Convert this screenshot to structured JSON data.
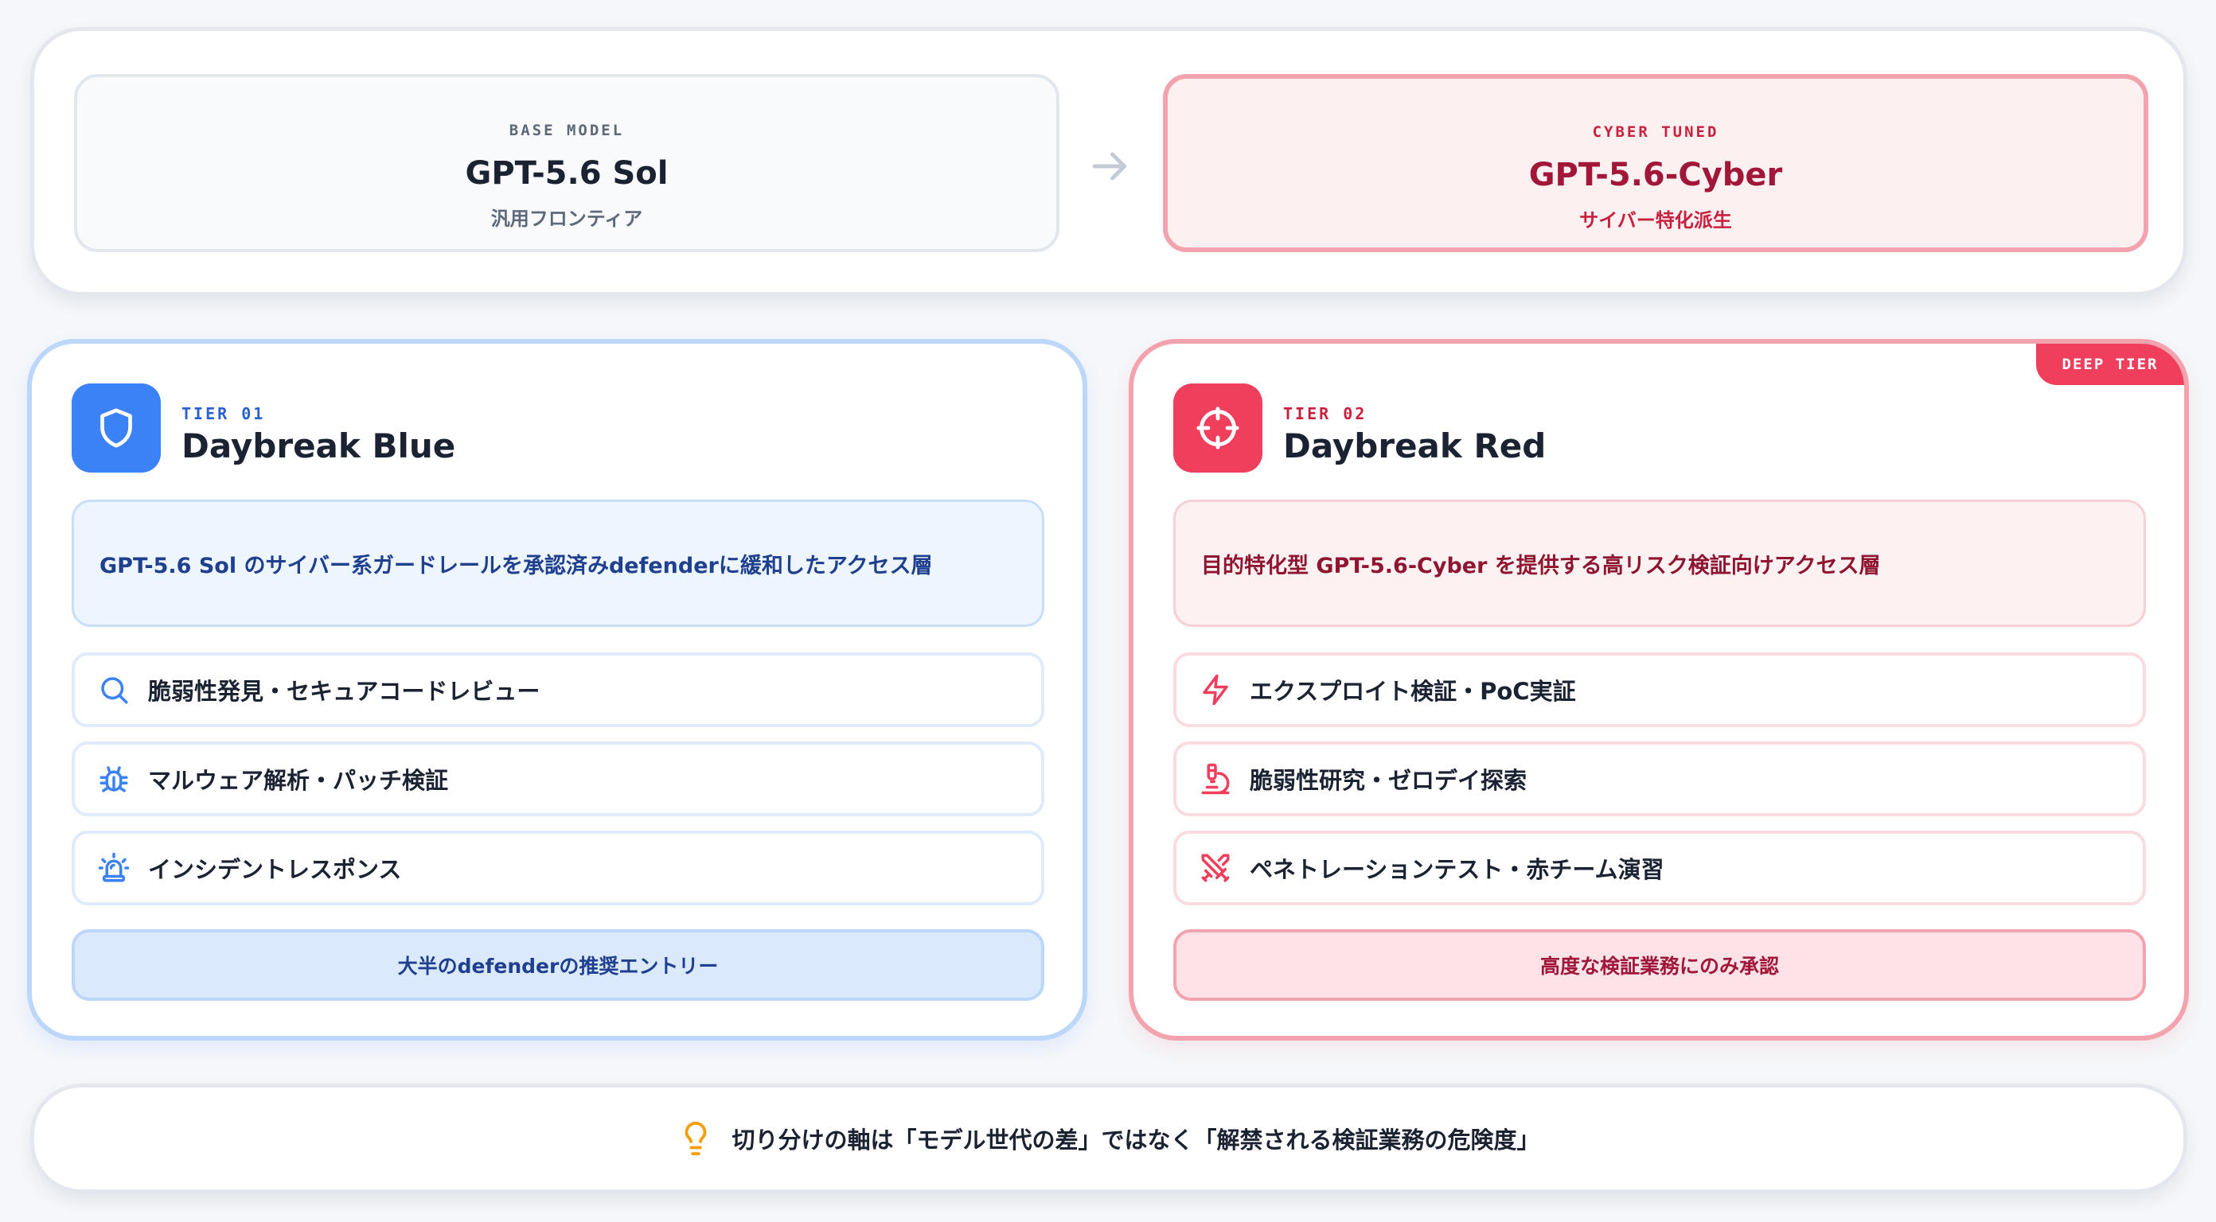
{
  "models": {
    "base": {
      "eyebrow": "BASE MODEL",
      "name": "GPT-5.6 Sol",
      "subtitle": "汎用フロンティア"
    },
    "cyber": {
      "eyebrow": "CYBER TUNED",
      "name": "GPT-5.6-Cyber",
      "subtitle": "サイバー特化派生"
    },
    "arrow_icon": "arrow-right"
  },
  "tiers": [
    {
      "label": "TIER 01",
      "name": "Daybreak Blue",
      "icon": "shield",
      "accent": "#3b82f6",
      "description": "GPT-5.6 Sol のサイバー系ガードレールを承認済みdefenderに緩和したアクセス層",
      "features": [
        {
          "icon": "search",
          "text": "脆弱性発見・セキュアコードレビュー"
        },
        {
          "icon": "bug",
          "text": "マルウェア解析・パッチ検証"
        },
        {
          "icon": "siren",
          "text": "インシデントレスポンス"
        }
      ],
      "cta": "大半のdefenderの推奨エントリー"
    },
    {
      "label": "TIER 02",
      "name": "Daybreak Red",
      "icon": "crosshair",
      "accent": "#f03e5d",
      "badge": "DEEP TIER",
      "description": "目的特化型 GPT-5.6-Cyber を提供する高リスク検証向けアクセス層",
      "features": [
        {
          "icon": "zap",
          "text": "エクスプロイト検証・PoC実証"
        },
        {
          "icon": "microscope",
          "text": "脆弱性研究・ゼロデイ探索"
        },
        {
          "icon": "swords",
          "text": "ペネトレーションテスト・赤チーム演習"
        }
      ],
      "cta": "高度な検証業務にのみ承認"
    }
  ],
  "note": {
    "icon": "lightbulb",
    "text": "切り分けの軸は「モデル世代の差」ではなく「解禁される検証業務の危険度」"
  }
}
